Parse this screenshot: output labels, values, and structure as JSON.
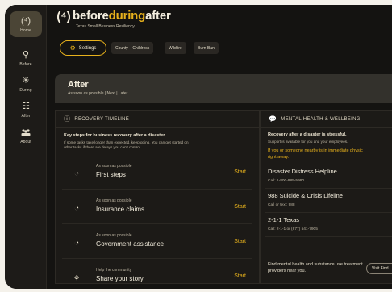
{
  "brand": {
    "mark": "(⁴)",
    "before": "before",
    "during": "during",
    "after": "after",
    "subtitle": "Texas Small Business Resiliency"
  },
  "sidebar": {
    "items": [
      {
        "label": "Home",
        "icon": "home-bolt-icon",
        "glyph": "(⁴)"
      },
      {
        "label": "Before",
        "icon": "location-icon",
        "glyph": "⚲"
      },
      {
        "label": "During",
        "icon": "alert-burst-icon",
        "glyph": "✳"
      },
      {
        "label": "After",
        "icon": "checklist-icon",
        "glyph": "☷"
      },
      {
        "label": "About",
        "icon": "people-icon",
        "glyph": "👥"
      }
    ]
  },
  "toolbar": {
    "settings_label": "Settings",
    "chips": [
      "County – Childress",
      "Wildfire",
      "Burn Ban"
    ]
  },
  "after": {
    "title": "After",
    "subtitle": "As soon as possible | Next | Later"
  },
  "recovery": {
    "header": "RECOVERY TIMELINE",
    "intro_title": "Key steps for business recovery after a disaster",
    "intro_text_1": "If some tasks take longer than expected, keep going. You can get started on",
    "intro_text_2": "other tasks if there are delays you can't control.",
    "steps": [
      {
        "when": "As soon as possible",
        "title": "First steps",
        "action": "Start"
      },
      {
        "when": "As soon as possible",
        "title": "Insurance claims",
        "action": "Start"
      },
      {
        "when": "As soon as possible",
        "title": "Government assistance",
        "action": "Start"
      },
      {
        "when": "Help the community",
        "title": "Share your story",
        "action": "Start"
      }
    ]
  },
  "mental": {
    "header": "MENTAL HEALTH & WELLBEING",
    "intro_title": "Recovery after a disaster is stressful.",
    "intro_text": "Support is available for you and your employees.",
    "crisis_1": "If you or someone nearby is in immediate physic",
    "crisis_2": "right away.",
    "resources": [
      {
        "name": "Disaster Distress Helpline",
        "call": "Call: 1-800-985-5990"
      },
      {
        "name": "988 Suicide & Crisis Lifeline",
        "call": "Call or text: 988"
      },
      {
        "name": "2-1-1 Texas",
        "call": "Call: 2-1-1 or (877) 541-7905"
      }
    ],
    "find_text": "Find mental health and substance use treatment providers near you.",
    "visit_label": "Visit Find"
  },
  "colors": {
    "accent": "#e7b11c",
    "background": "#141311",
    "panel": "#1c1a17"
  }
}
